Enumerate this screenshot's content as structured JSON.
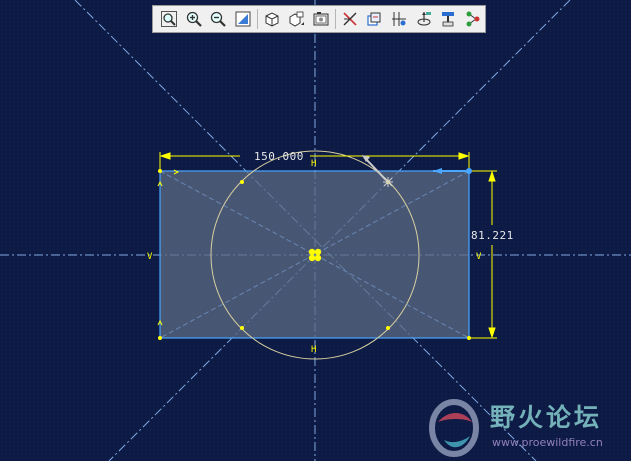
{
  "toolbar": {
    "buttons": [
      {
        "name": "zoom-window-icon"
      },
      {
        "name": "zoom-in-icon"
      },
      {
        "name": "zoom-out-icon"
      },
      {
        "name": "refit-icon"
      },
      {
        "name": "display-style-icon"
      },
      {
        "name": "saved-views-icon"
      },
      {
        "name": "view-manager-icon"
      },
      {
        "name": "datum-display-icon"
      },
      {
        "name": "axis-display-icon"
      },
      {
        "name": "point-display-icon"
      },
      {
        "name": "csys-display-icon"
      },
      {
        "name": "spin-center-icon"
      },
      {
        "name": "annotation-icon"
      }
    ]
  },
  "sketch": {
    "dim_width": "150.000",
    "dim_height": "81.221",
    "constraint_h": "H",
    "constraint_v": "V",
    "colors": {
      "background": "#0c1a44",
      "centerline": "#7fa8df",
      "dimension": "#ffff00",
      "rectangle_edge": "#4aa6ff",
      "rectangle_fill": "#5b6b83",
      "circle": "#d8cfa0",
      "vertex": "#ffff00"
    }
  },
  "watermark": {
    "title": "野火论坛",
    "url": "www.proewildfire.cn"
  }
}
